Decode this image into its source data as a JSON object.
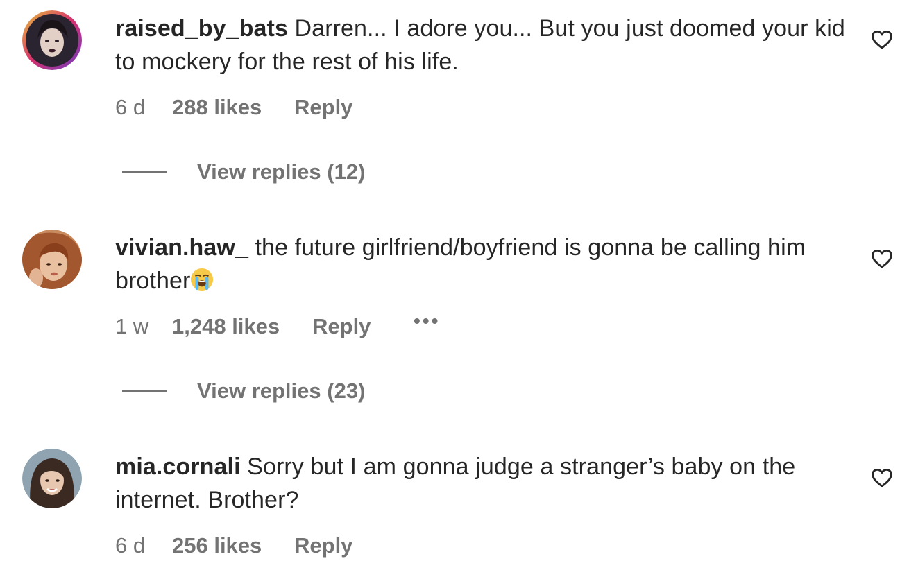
{
  "comments": [
    {
      "username": "raised_by_bats",
      "text": "Darren... I adore you... But you just doomed your kid to mockery for the rest of his life.",
      "time": "6 d",
      "likes": "288 likes",
      "reply_label": "Reply",
      "view_replies": "View replies (12)",
      "avatar_icon": "user-avatar"
    },
    {
      "username": "vivian.haw_",
      "text": "the future girlfriend/boyfriend is gonna be calling him brother",
      "emoji": "loudly-crying-face",
      "time": "1 w",
      "likes": "1,248 likes",
      "reply_label": "Reply",
      "more_label": "•••",
      "view_replies": "View replies (23)",
      "avatar_icon": "user-avatar"
    },
    {
      "username": "mia.cornali",
      "text": "Sorry but I am gonna judge a stranger’s baby on the internet. Brother?",
      "time": "6 d",
      "likes": "256 likes",
      "reply_label": "Reply",
      "avatar_icon": "user-avatar"
    }
  ],
  "icons": {
    "like": "heart-outline-icon"
  },
  "colors": {
    "text": "#262626",
    "secondary": "#737373"
  }
}
